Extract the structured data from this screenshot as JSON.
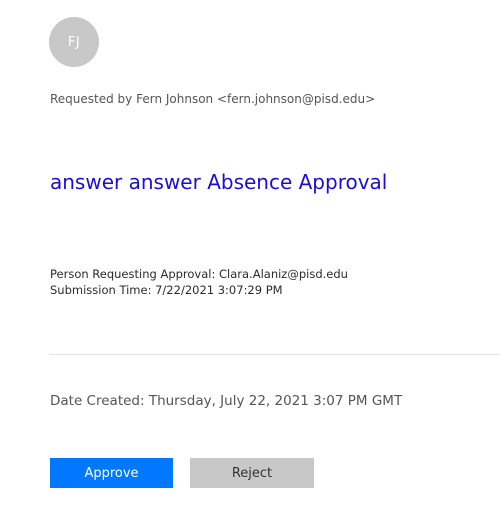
{
  "avatar": {
    "initials": "FJ"
  },
  "requested_by": "Requested by Fern Johnson <fern.johnson@pisd.edu>",
  "title": "answer answer Absence Approval",
  "details": {
    "person_requesting": "Person Requesting Approval: Clara.Alaniz@pisd.edu",
    "submission_time": "Submission Time: 7/22/2021 3:07:29 PM"
  },
  "date_created": "Date Created: Thursday, July 22, 2021 3:07 PM GMT",
  "actions": {
    "approve_label": "Approve",
    "reject_label": "Reject"
  },
  "colors": {
    "title": "#1a0dd8",
    "approve": "#0078ff",
    "reject": "#c8c8c8",
    "avatar": "#c8c8c8"
  }
}
